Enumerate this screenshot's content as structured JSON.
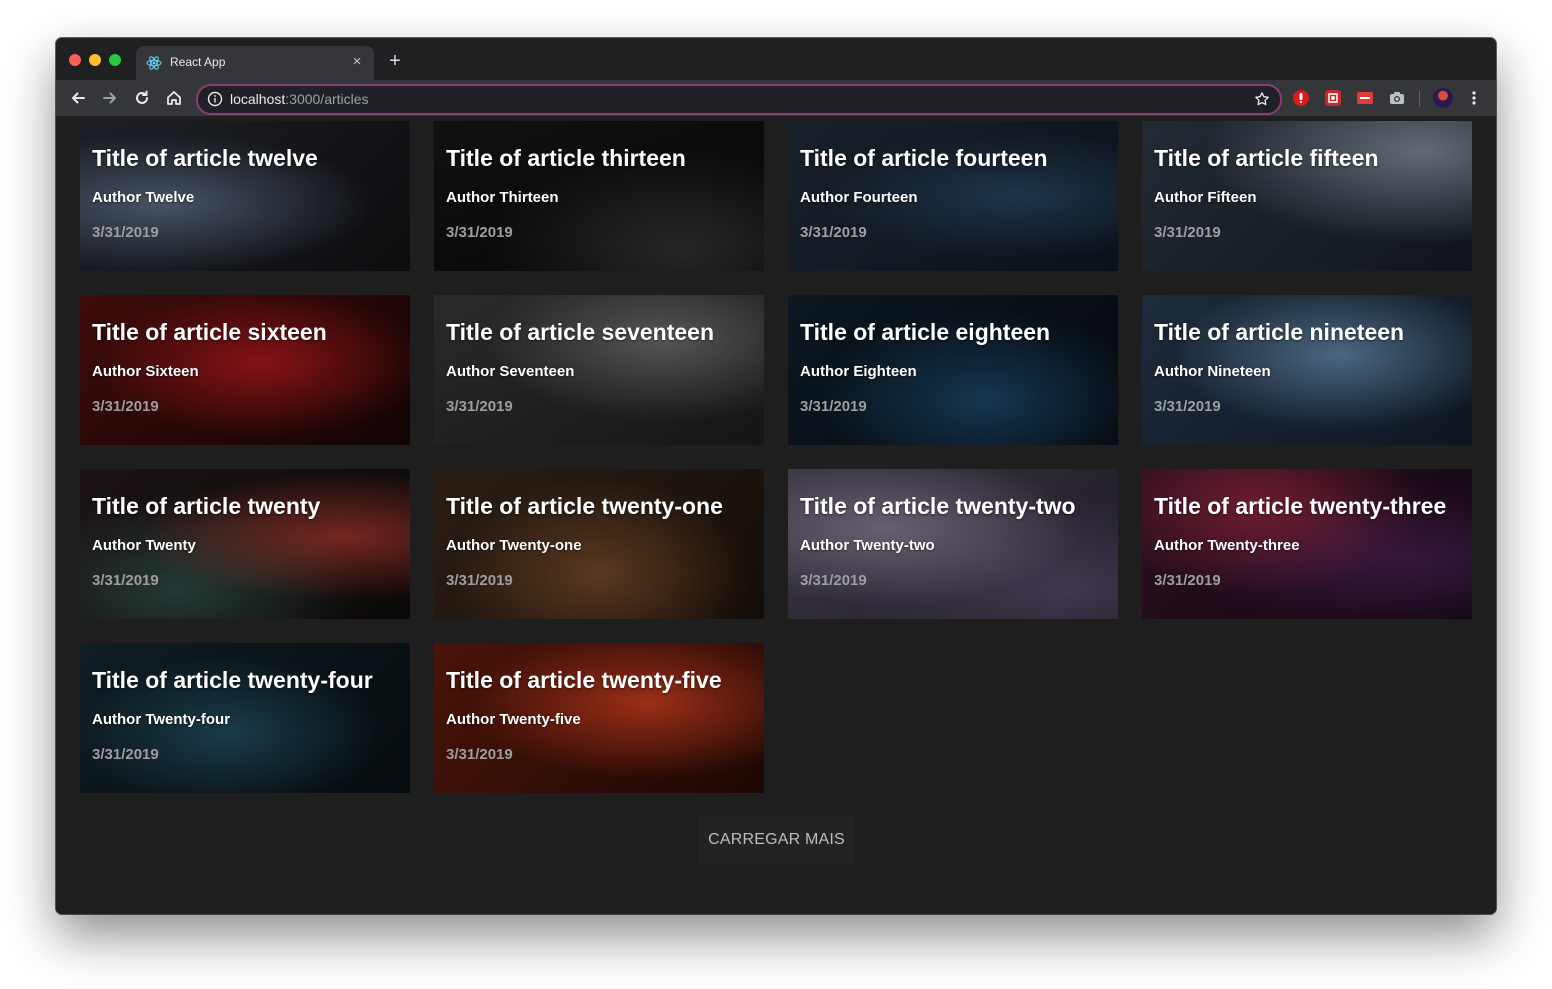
{
  "browser": {
    "tab_title": "React App",
    "tab_close": "×",
    "new_tab": "+",
    "url_host": "localhost",
    "url_path": ":3000/articles"
  },
  "articles": [
    {
      "title": "Title of article twelve",
      "author": "Author Twelve",
      "date": "3/31/2019"
    },
    {
      "title": "Title of article thirteen",
      "author": "Author Thirteen",
      "date": "3/31/2019"
    },
    {
      "title": "Title of article fourteen",
      "author": "Author Fourteen",
      "date": "3/31/2019"
    },
    {
      "title": "Title of article fifteen",
      "author": "Author Fifteen",
      "date": "3/31/2019"
    },
    {
      "title": "Title of article sixteen",
      "author": "Author Sixteen",
      "date": "3/31/2019"
    },
    {
      "title": "Title of article seventeen",
      "author": "Author Seventeen",
      "date": "3/31/2019"
    },
    {
      "title": "Title of article eighteen",
      "author": "Author Eighteen",
      "date": "3/31/2019"
    },
    {
      "title": "Title of article nineteen",
      "author": "Author Nineteen",
      "date": "3/31/2019"
    },
    {
      "title": "Title of article twenty",
      "author": "Author Twenty",
      "date": "3/31/2019"
    },
    {
      "title": "Title of article twenty-one",
      "author": "Author Twenty-one",
      "date": "3/31/2019"
    },
    {
      "title": "Title of article twenty-two",
      "author": "Author Twenty-two",
      "date": "3/31/2019"
    },
    {
      "title": "Title of article twenty-three",
      "author": "Author Twenty-three",
      "date": "3/31/2019"
    },
    {
      "title": "Title of article twenty-four",
      "author": "Author Twenty-four",
      "date": "3/31/2019"
    },
    {
      "title": "Title of article twenty-five",
      "author": "Author Twenty-five",
      "date": "3/31/2019"
    }
  ],
  "load_more_label": "CARREGAR MAIS",
  "icons": {
    "back": "back-arrow-icon",
    "forward": "forward-arrow-icon",
    "reload": "reload-icon",
    "home": "home-icon",
    "info": "info-icon",
    "star": "bookmark-star-icon",
    "menu": "kebab-menu-icon"
  },
  "colors": {
    "page_background": "#1e1e1e",
    "omnibox_border": "#8a3d72",
    "button_background": "#232323",
    "date_text": "#9e9e9e"
  }
}
